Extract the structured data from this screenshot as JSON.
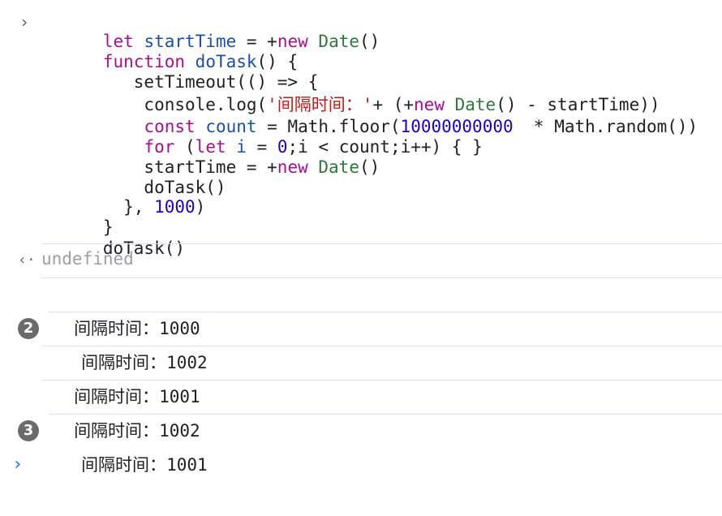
{
  "input": {
    "lines": [
      "let startTime = +new Date()",
      "function doTask() {",
      "   setTimeout(() => {",
      "    console.log('间隔时间：'+ (+new Date() - startTime))",
      "    const count = Math.floor(10000000000  * Math.random())",
      "    for (let i = 0;i < count;i++) { }",
      "    startTime = +new Date()",
      "    doTask()",
      "  }, 1000)",
      "}",
      "doTask()"
    ]
  },
  "result": {
    "value": "undefined"
  },
  "logs": [
    {
      "label": "间隔时间：",
      "value": "1000",
      "count": null
    },
    {
      "label": "间隔时间：",
      "value": "1002",
      "count": "2"
    },
    {
      "label": "间隔时间：",
      "value": "1001",
      "count": null
    },
    {
      "label": "间隔时间：",
      "value": "1002",
      "count": null
    },
    {
      "label": "间隔时间：",
      "value": "1001",
      "count": "3"
    }
  ],
  "icons": {
    "input_prompt": "chevron-right-icon",
    "result": "return-arrow-icon",
    "new_prompt": "chevron-right-icon"
  },
  "colors": {
    "keyword": "#aa0d91",
    "variable": "#1c00cf",
    "string": "#c41a16",
    "class": "#2b7a3b",
    "badge": "#6b6b6b",
    "divider": "#d5e2f7",
    "prompt": "#1a73e8"
  }
}
